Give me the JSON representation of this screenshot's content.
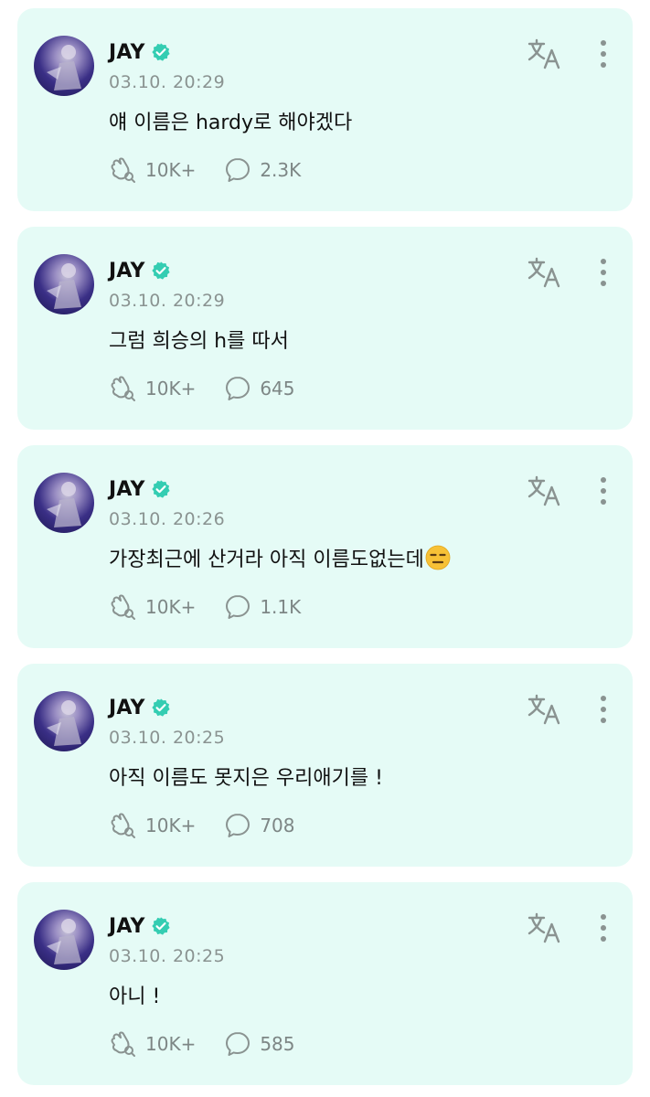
{
  "colors": {
    "card_bg": "#e5fbf6",
    "verified": "#34cdb2",
    "meta_text": "#8a9391",
    "icon_gray": "#8a9391"
  },
  "posts": [
    {
      "author": "JAY",
      "timestamp": "03.10. 20:29",
      "text": "얘 이름은 hardy로 해야겠다",
      "emoji": "",
      "likes": "10K+",
      "comments": "2.3K",
      "icons": [
        "avatar",
        "verified-badge-icon",
        "translate-icon",
        "more-vertical-icon",
        "like-icon",
        "comment-icon"
      ]
    },
    {
      "author": "JAY",
      "timestamp": "03.10. 20:29",
      "text": "그럼 희승의 h를 따서",
      "emoji": "",
      "likes": "10K+",
      "comments": "645",
      "icons": [
        "avatar",
        "verified-badge-icon",
        "translate-icon",
        "more-vertical-icon",
        "like-icon",
        "comment-icon"
      ]
    },
    {
      "author": "JAY",
      "timestamp": "03.10. 20:26",
      "text": "가장최근에 산거라 아직 이름도없는데",
      "emoji": "expressionless-face",
      "likes": "10K+",
      "comments": "1.1K",
      "icons": [
        "avatar",
        "verified-badge-icon",
        "translate-icon",
        "more-vertical-icon",
        "like-icon",
        "comment-icon"
      ]
    },
    {
      "author": "JAY",
      "timestamp": "03.10. 20:25",
      "text": "아직 이름도 못지은 우리애기를 !",
      "emoji": "",
      "likes": "10K+",
      "comments": "708",
      "icons": [
        "avatar",
        "verified-badge-icon",
        "translate-icon",
        "more-vertical-icon",
        "like-icon",
        "comment-icon"
      ]
    },
    {
      "author": "JAY",
      "timestamp": "03.10. 20:25",
      "text": "아니 !",
      "emoji": "",
      "likes": "10K+",
      "comments": "585",
      "icons": [
        "avatar",
        "verified-badge-icon",
        "translate-icon",
        "more-vertical-icon",
        "like-icon",
        "comment-icon"
      ]
    }
  ]
}
